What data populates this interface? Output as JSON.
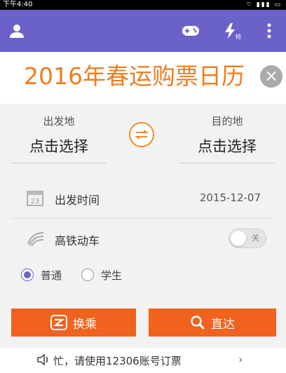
{
  "status_bar": {
    "time": "下午4:40",
    "icons": "⌔ ▮▮▮ ▭"
  },
  "header": {
    "icons": [
      "user-icon",
      "gamepad-icon",
      "flash-grab-icon",
      "more-vert-icon"
    ],
    "flash_sub": "抢"
  },
  "banner": {
    "text": "2016年春运购票日历",
    "close": "×"
  },
  "route": {
    "from_label": "出发地",
    "from_value": "点击选择",
    "to_label": "目的地",
    "to_value": "点击选择"
  },
  "date": {
    "icon_number": "23",
    "label": "出发时间",
    "value": "2015-12-07"
  },
  "gaotie": {
    "label": "高铁动车",
    "toggle_text": "关",
    "enabled": false
  },
  "ticket_type": {
    "options": [
      "普通",
      "学生"
    ],
    "selected": "普通"
  },
  "buttons": {
    "transfer": "换乘",
    "direct": "直达"
  },
  "notice": {
    "text": "忙，请使用12306账号订票",
    "arrow": "›"
  },
  "colors": {
    "primary": "#6a62c8",
    "accent": "#f0621d",
    "banner": "#f07d1e"
  }
}
